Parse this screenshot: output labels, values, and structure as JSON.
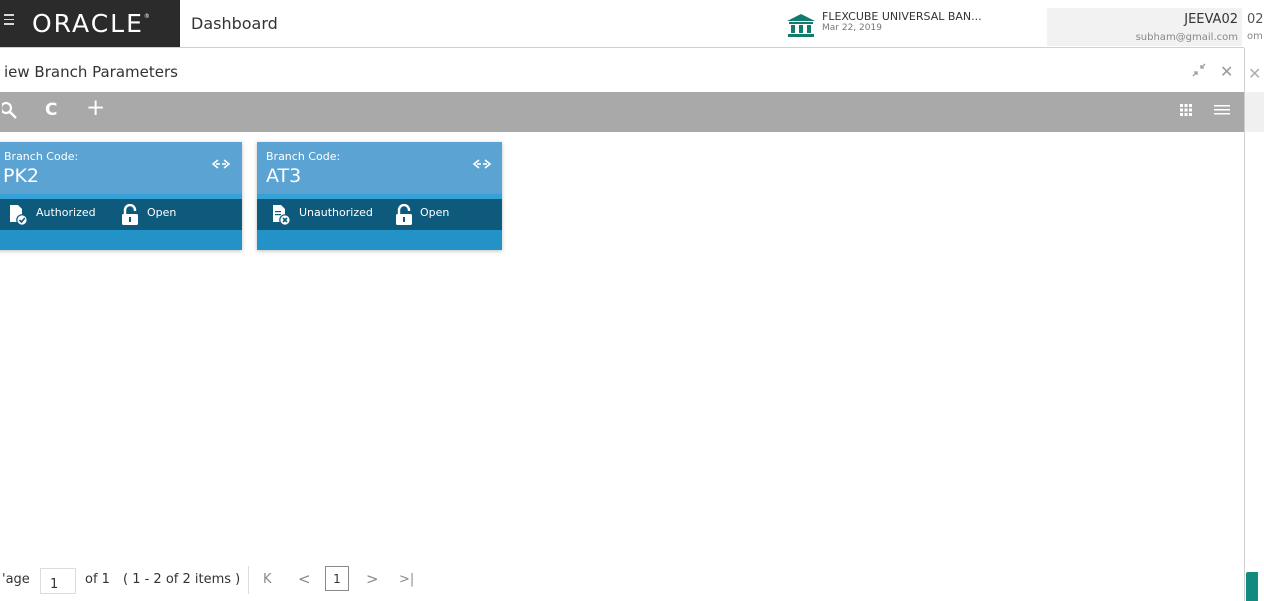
{
  "header": {
    "brand": "ORACLE",
    "app_title": "Dashboard",
    "bank_name": "FLEXCUBE UNIVERSAL BAN...",
    "bank_date": "Mar 22, 2019",
    "user_name": "JEEVA02",
    "user_email": "subham@gmail.com",
    "user_name_ghost": "02",
    "user_email_ghost": "om"
  },
  "modal": {
    "title": "iew Branch Parameters"
  },
  "toolbar": {
    "icons": [
      "search-icon",
      "refresh-icon",
      "add-icon",
      "grid-view-icon",
      "list-view-icon"
    ]
  },
  "cards": [
    {
      "label": "Branch Code:",
      "value": "PK2",
      "auth_status": "Authorized",
      "record_status": "Open"
    },
    {
      "label": "Branch Code:",
      "value": "AT3",
      "auth_status": "Unauthorized",
      "record_status": "Open"
    }
  ],
  "pagination": {
    "page_label": "'age",
    "current_page": "1",
    "of_label": "of 1",
    "items_label": "( 1 - 2 of 2 items )",
    "page_number": "1"
  },
  "colors": {
    "header_dark": "#2b2b2b",
    "toolbar": "#a9a9a9",
    "card_top": "#5ba3d3",
    "card_mid": "#0e5a7d",
    "card_bottom": "#2392c7",
    "bank_icon": "#137a6e"
  }
}
